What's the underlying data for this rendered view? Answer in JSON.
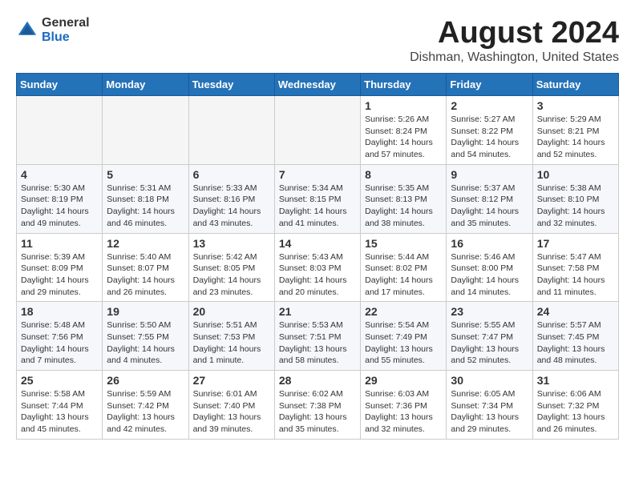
{
  "header": {
    "logo_general": "General",
    "logo_blue": "Blue",
    "month_title": "August 2024",
    "location": "Dishman, Washington, United States"
  },
  "days_of_week": [
    "Sunday",
    "Monday",
    "Tuesday",
    "Wednesday",
    "Thursday",
    "Friday",
    "Saturday"
  ],
  "weeks": [
    [
      {
        "day": "",
        "info": ""
      },
      {
        "day": "",
        "info": ""
      },
      {
        "day": "",
        "info": ""
      },
      {
        "day": "",
        "info": ""
      },
      {
        "day": "1",
        "info": "Sunrise: 5:26 AM\nSunset: 8:24 PM\nDaylight: 14 hours\nand 57 minutes."
      },
      {
        "day": "2",
        "info": "Sunrise: 5:27 AM\nSunset: 8:22 PM\nDaylight: 14 hours\nand 54 minutes."
      },
      {
        "day": "3",
        "info": "Sunrise: 5:29 AM\nSunset: 8:21 PM\nDaylight: 14 hours\nand 52 minutes."
      }
    ],
    [
      {
        "day": "4",
        "info": "Sunrise: 5:30 AM\nSunset: 8:19 PM\nDaylight: 14 hours\nand 49 minutes."
      },
      {
        "day": "5",
        "info": "Sunrise: 5:31 AM\nSunset: 8:18 PM\nDaylight: 14 hours\nand 46 minutes."
      },
      {
        "day": "6",
        "info": "Sunrise: 5:33 AM\nSunset: 8:16 PM\nDaylight: 14 hours\nand 43 minutes."
      },
      {
        "day": "7",
        "info": "Sunrise: 5:34 AM\nSunset: 8:15 PM\nDaylight: 14 hours\nand 41 minutes."
      },
      {
        "day": "8",
        "info": "Sunrise: 5:35 AM\nSunset: 8:13 PM\nDaylight: 14 hours\nand 38 minutes."
      },
      {
        "day": "9",
        "info": "Sunrise: 5:37 AM\nSunset: 8:12 PM\nDaylight: 14 hours\nand 35 minutes."
      },
      {
        "day": "10",
        "info": "Sunrise: 5:38 AM\nSunset: 8:10 PM\nDaylight: 14 hours\nand 32 minutes."
      }
    ],
    [
      {
        "day": "11",
        "info": "Sunrise: 5:39 AM\nSunset: 8:09 PM\nDaylight: 14 hours\nand 29 minutes."
      },
      {
        "day": "12",
        "info": "Sunrise: 5:40 AM\nSunset: 8:07 PM\nDaylight: 14 hours\nand 26 minutes."
      },
      {
        "day": "13",
        "info": "Sunrise: 5:42 AM\nSunset: 8:05 PM\nDaylight: 14 hours\nand 23 minutes."
      },
      {
        "day": "14",
        "info": "Sunrise: 5:43 AM\nSunset: 8:03 PM\nDaylight: 14 hours\nand 20 minutes."
      },
      {
        "day": "15",
        "info": "Sunrise: 5:44 AM\nSunset: 8:02 PM\nDaylight: 14 hours\nand 17 minutes."
      },
      {
        "day": "16",
        "info": "Sunrise: 5:46 AM\nSunset: 8:00 PM\nDaylight: 14 hours\nand 14 minutes."
      },
      {
        "day": "17",
        "info": "Sunrise: 5:47 AM\nSunset: 7:58 PM\nDaylight: 14 hours\nand 11 minutes."
      }
    ],
    [
      {
        "day": "18",
        "info": "Sunrise: 5:48 AM\nSunset: 7:56 PM\nDaylight: 14 hours\nand 7 minutes."
      },
      {
        "day": "19",
        "info": "Sunrise: 5:50 AM\nSunset: 7:55 PM\nDaylight: 14 hours\nand 4 minutes."
      },
      {
        "day": "20",
        "info": "Sunrise: 5:51 AM\nSunset: 7:53 PM\nDaylight: 14 hours\nand 1 minute."
      },
      {
        "day": "21",
        "info": "Sunrise: 5:53 AM\nSunset: 7:51 PM\nDaylight: 13 hours\nand 58 minutes."
      },
      {
        "day": "22",
        "info": "Sunrise: 5:54 AM\nSunset: 7:49 PM\nDaylight: 13 hours\nand 55 minutes."
      },
      {
        "day": "23",
        "info": "Sunrise: 5:55 AM\nSunset: 7:47 PM\nDaylight: 13 hours\nand 52 minutes."
      },
      {
        "day": "24",
        "info": "Sunrise: 5:57 AM\nSunset: 7:45 PM\nDaylight: 13 hours\nand 48 minutes."
      }
    ],
    [
      {
        "day": "25",
        "info": "Sunrise: 5:58 AM\nSunset: 7:44 PM\nDaylight: 13 hours\nand 45 minutes."
      },
      {
        "day": "26",
        "info": "Sunrise: 5:59 AM\nSunset: 7:42 PM\nDaylight: 13 hours\nand 42 minutes."
      },
      {
        "day": "27",
        "info": "Sunrise: 6:01 AM\nSunset: 7:40 PM\nDaylight: 13 hours\nand 39 minutes."
      },
      {
        "day": "28",
        "info": "Sunrise: 6:02 AM\nSunset: 7:38 PM\nDaylight: 13 hours\nand 35 minutes."
      },
      {
        "day": "29",
        "info": "Sunrise: 6:03 AM\nSunset: 7:36 PM\nDaylight: 13 hours\nand 32 minutes."
      },
      {
        "day": "30",
        "info": "Sunrise: 6:05 AM\nSunset: 7:34 PM\nDaylight: 13 hours\nand 29 minutes."
      },
      {
        "day": "31",
        "info": "Sunrise: 6:06 AM\nSunset: 7:32 PM\nDaylight: 13 hours\nand 26 minutes."
      }
    ]
  ]
}
